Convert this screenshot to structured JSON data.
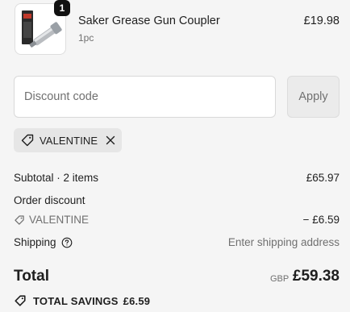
{
  "product": {
    "name": "Saker Grease Gun Coupler",
    "variant": "1pc",
    "price": "£19.98",
    "quantity": "1",
    "image_icon": "grease-gun-coupler-product-image"
  },
  "discount": {
    "placeholder": "Discount code",
    "apply_label": "Apply",
    "applied_code": "VALENTINE"
  },
  "summary": {
    "subtotal_label": "Subtotal · 2 items",
    "subtotal_value": "£65.97",
    "order_discount_label": "Order discount",
    "discount_code": "VALENTINE",
    "discount_value": "− £6.59",
    "shipping_label": "Shipping",
    "shipping_value": "Enter shipping address"
  },
  "total": {
    "label": "Total",
    "currency": "GBP",
    "value": "£59.38",
    "savings_label": "TOTAL SAVINGS",
    "savings_value": "£6.59"
  },
  "colors": {
    "background": "#f5f5f5",
    "text": "#1f1f1f",
    "muted": "#707070",
    "chip": "#e6e6e6",
    "badge": "#111111"
  }
}
